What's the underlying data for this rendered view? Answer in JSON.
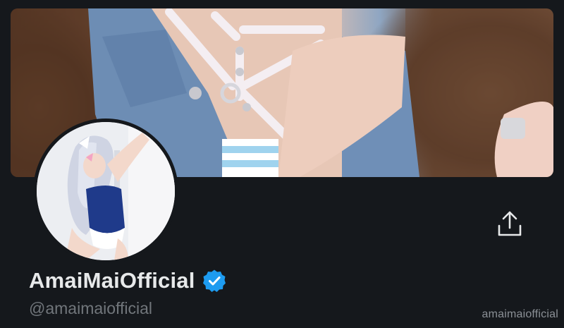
{
  "profile": {
    "display_name": "AmaiMaiOfficial",
    "handle": "@amaimaiofficial",
    "verified": true,
    "watermark": "amaimaiofficial"
  },
  "icons": {
    "share": "share-upload-icon",
    "verified": "verified-badge-icon"
  },
  "colors": {
    "background": "#15181c",
    "name_text": "#e7e9ea",
    "handle_text": "#71767b",
    "verified_blue": "#1d9bf0"
  }
}
